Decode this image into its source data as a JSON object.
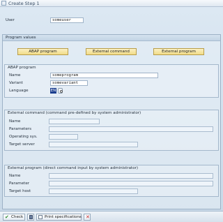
{
  "window": {
    "title": "Create Step 1"
  },
  "user": {
    "label": "User",
    "value": "someuser"
  },
  "program_values": {
    "header": "Program values",
    "buttons": {
      "abap": "ABAP program",
      "external_command": "External command",
      "external_program": "External program"
    }
  },
  "abap_program": {
    "header": "ABAP program",
    "name_label": "Name",
    "name_value": "someprogram",
    "variant_label": "Variant",
    "variant_value": "somevariant",
    "language_label": "Language",
    "language_value": "EN"
  },
  "external_command": {
    "header": "External command (command pre-defined by system administrator)",
    "name_label": "Name",
    "parameters_label": "Parameters",
    "operating_sys_label": "Operating sys.",
    "target_server_label": "Target server"
  },
  "external_program": {
    "header": "External program (direct command input by system administrator)",
    "name_label": "Name",
    "parameter_label": "Parameter",
    "target_host_label": "Target host"
  },
  "footer": {
    "check": "Check",
    "print_specifications": "Print specifications"
  },
  "icons": {
    "check": "checkmark-icon",
    "save": "save-icon",
    "print": "print-icon",
    "cancel": "cancel-icon",
    "window": "window-icon"
  }
}
